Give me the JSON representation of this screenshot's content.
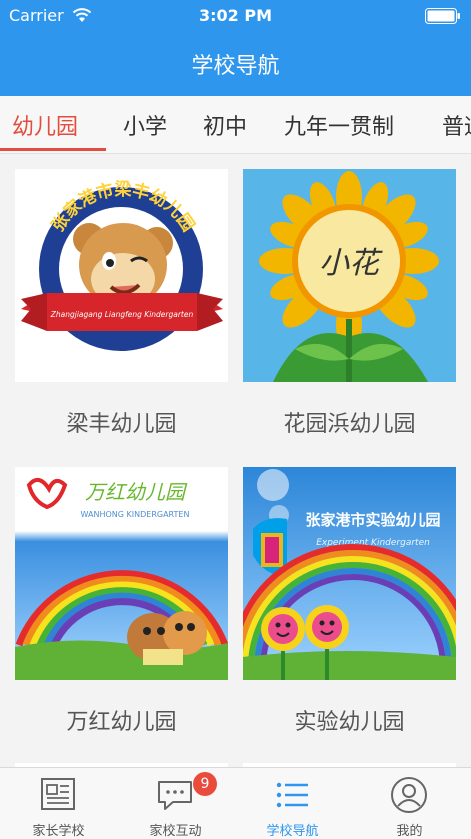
{
  "status_bar": {
    "carrier": "Carrier",
    "time": "3:02 PM"
  },
  "nav": {
    "title": "学校导航"
  },
  "tabs": [
    {
      "label": "幼儿园",
      "active": true
    },
    {
      "label": "小学",
      "active": false
    },
    {
      "label": "初中",
      "active": false
    },
    {
      "label": "九年一贯制",
      "active": false
    },
    {
      "label": "普通",
      "active": false
    }
  ],
  "schools": [
    {
      "name": "梁丰幼儿园",
      "logo_text": "张家港市梁丰幼儿园",
      "logo_subtext": "Zhangjiagang Liangfeng Kindergarten"
    },
    {
      "name": "花园浜幼儿园",
      "logo_text": "小花"
    },
    {
      "name": "万红幼儿园",
      "logo_text": "万红幼儿园",
      "logo_subtext": "WANHONG KINDERGARTEN"
    },
    {
      "name": "实验幼儿园",
      "logo_text": "张家港市实验幼儿园",
      "logo_subtext": "Experiment Kindergarten"
    }
  ],
  "tabbar": {
    "items": [
      {
        "label": "家长学校",
        "icon": "newspaper-icon",
        "active": false
      },
      {
        "label": "家校互动",
        "icon": "chat-bubble-icon",
        "active": false,
        "badge": "9"
      },
      {
        "label": "学校导航",
        "icon": "list-icon",
        "active": true
      },
      {
        "label": "我的",
        "icon": "user-icon",
        "active": false
      }
    ]
  },
  "colors": {
    "accent": "#2f96ee",
    "tab_active": "#e24d3d",
    "badge": "#e94b3c"
  }
}
